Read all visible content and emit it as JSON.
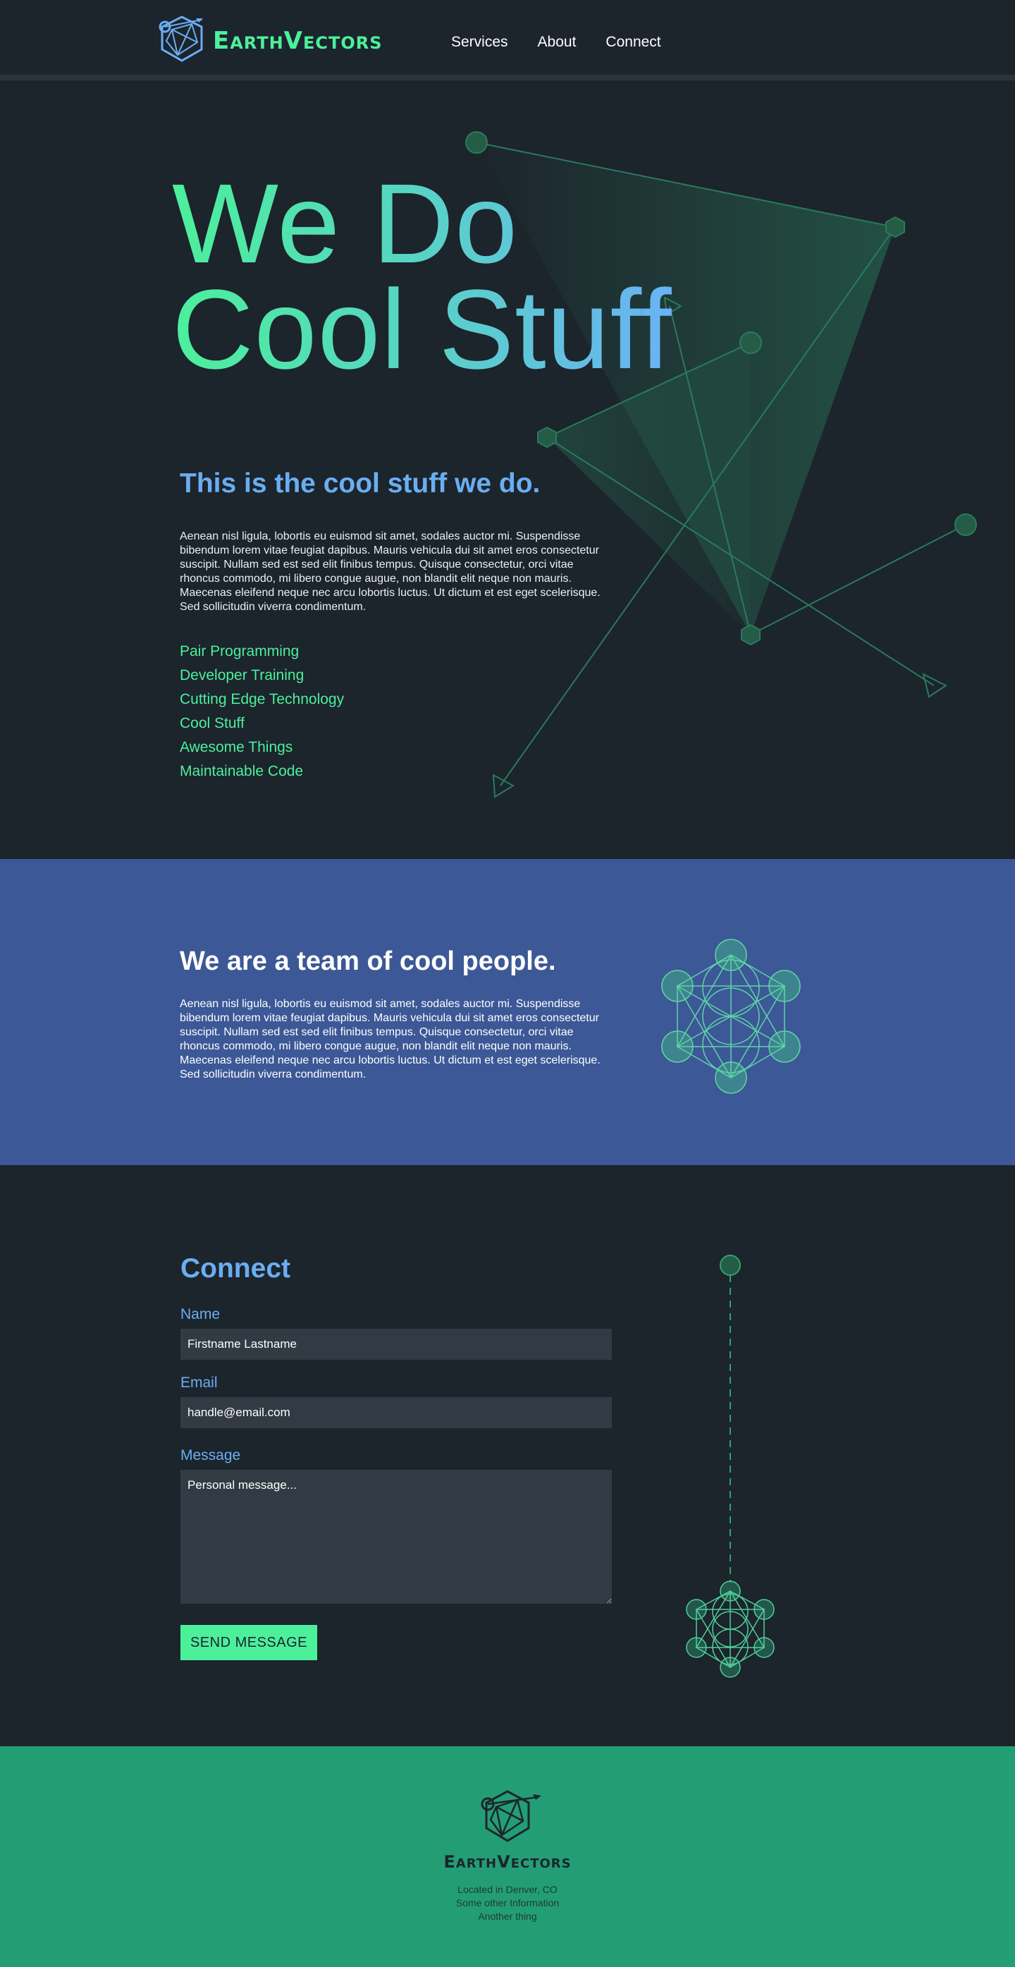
{
  "brand": {
    "name_first_cap": "E",
    "name_first_rest": "ARTH",
    "name_second_cap": "V",
    "name_second_rest": "ECTORS"
  },
  "nav": [
    {
      "label": "Services"
    },
    {
      "label": "About"
    },
    {
      "label": "Connect"
    }
  ],
  "hero": {
    "title_line1": "We Do",
    "title_line2": "Cool Stuff",
    "subtitle": "This is the cool stuff we do.",
    "paragraph": "Aenean nisl ligula, lobortis eu euismod sit amet, sodales auctor mi. Suspendisse bibendum lorem vitae feugiat dapibus. Mauris vehicula dui sit amet eros consectetur suscipit. Nullam sed est sed elit finibus tempus. Quisque consectetur, orci vitae rhoncus commodo, mi libero congue augue, non blandit elit neque non mauris. Maecenas eleifend neque nec arcu lobortis luctus. Ut dictum et est eget scelerisque. Sed sollicitudin viverra condimentum.",
    "services": [
      "Pair Programming",
      "Developer Training",
      "Cutting Edge Technology",
      "Cool Stuff",
      "Awesome Things",
      "Maintainable Code"
    ]
  },
  "team": {
    "title": "We are a team of cool people.",
    "paragraph": "Aenean nisl ligula, lobortis eu euismod sit amet, sodales auctor mi. Suspendisse bibendum lorem vitae feugiat dapibus. Mauris vehicula dui sit amet eros consectetur suscipit. Nullam sed est sed elit finibus tempus. Quisque consectetur, orci vitae rhoncus commodo, mi libero congue augue, non blandit elit neque non mauris. Maecenas eleifend neque nec arcu lobortis luctus. Ut dictum et est eget scelerisque. Sed sollicitudin viverra condimentum."
  },
  "connect": {
    "title": "Connect",
    "name_label": "Name",
    "name_value": "Firstname Lastname",
    "email_label": "Email",
    "email_value": "handle@email.com",
    "message_label": "Message",
    "message_value": "Personal message...",
    "send_label": "SEND MESSAGE"
  },
  "footer": {
    "lines": [
      "Located in Denver, CO",
      "Some other Information",
      "Another thing"
    ]
  },
  "colors": {
    "background": "#1c242c",
    "accent_green": "#4cf09b",
    "accent_blue": "#6aaef2",
    "team_blue": "#3c5896",
    "footer_green": "#239e74",
    "field_bg": "#323a43"
  }
}
